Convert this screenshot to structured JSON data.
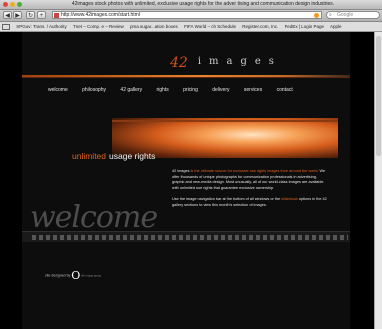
{
  "window": {
    "title": "42images stock photos with unlimited, exclusive usage rights for the adver tising and communication design industries."
  },
  "toolbar": {
    "back": "◀",
    "forward": "▶",
    "reload": "↻",
    "add": "+",
    "url": "http://www.42images.com/start.html",
    "search_placeholder": "Google"
  },
  "bookmarks": [
    "SPGov: Trans. / Authority",
    "Tnet – Comp. e – Review",
    "pma.sugar...ation boxes",
    "FIFA World – ch Schedule",
    "Register.com, Inc.",
    "FedEx | Login Page",
    "Apple"
  ],
  "site": {
    "logo_number": "42",
    "logo_word": "images",
    "nav": [
      "welcome",
      "philosophy",
      "42 gallery",
      "rights",
      "pricing",
      "delivery",
      "services",
      "contact"
    ],
    "heading_accent": "unlimited",
    "heading_main": "usage rights",
    "para1": {
      "lead": "42 images",
      "highlight": "is the ultimate source for exclusive use rights images from around the world.",
      "rest": "We offer thousands of unique photographs for communication professionals in advertising, graphic and new-media design. Most unusually, all of our world-class images are available with unlimited use rights that guarantee exclusive ownership."
    },
    "para2": {
      "lead": "Use the image navigation bar at the bottom of all windows or the",
      "highlight": "slideshow",
      "rest": "options in the 42 gallery sections to view this month's selection of images."
    },
    "welcome_script": "welcome",
    "credit_lead": "site designed by",
    "credit_mark": "O",
    "credit_tail": "life image group"
  },
  "colors": {
    "accent": "#e0611f",
    "background": "#000000"
  }
}
